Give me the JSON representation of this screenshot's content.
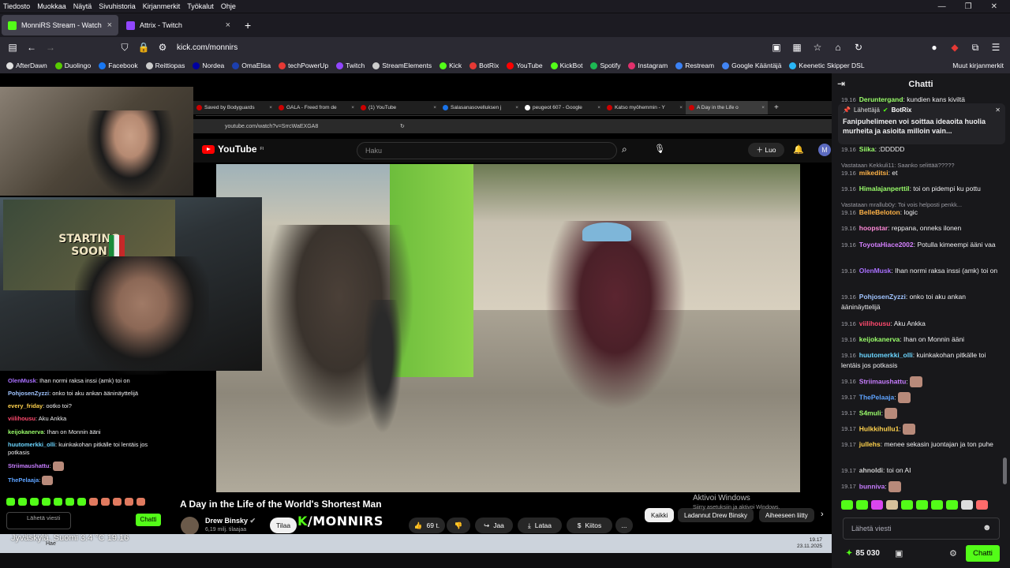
{
  "menubar": [
    "Tiedosto",
    "Muokkaa",
    "Näytä",
    "Sivuhistoria",
    "Kirjanmerkit",
    "Työkalut",
    "Ohje"
  ],
  "tabs": [
    {
      "label": "MonniRS Stream - Watch Li",
      "color": "#53fc18",
      "active": true
    },
    {
      "label": "Attrix - Twitch",
      "color": "#9146ff",
      "active": false
    }
  ],
  "nav": {
    "url": "kick.com/monnirs"
  },
  "bookmarks": [
    {
      "label": "AfterDawn",
      "color": "#e0e0e0"
    },
    {
      "label": "Duolingo",
      "color": "#58cc02"
    },
    {
      "label": "Facebook",
      "color": "#1877f2"
    },
    {
      "label": "Reittiopas",
      "color": "#cccccc"
    },
    {
      "label": "Nordea",
      "color": "#0000a0"
    },
    {
      "label": "OmaElisa",
      "color": "#1c3fae"
    },
    {
      "label": "techPowerUp",
      "color": "#e53935"
    },
    {
      "label": "Twitch",
      "color": "#9146ff"
    },
    {
      "label": "StreamElements",
      "color": "#cccccc"
    },
    {
      "label": "Kick",
      "color": "#53fc18"
    },
    {
      "label": "BotRix",
      "color": "#e53935"
    },
    {
      "label": "YouTube",
      "color": "#ff0000"
    },
    {
      "label": "KickBot",
      "color": "#53fc18"
    },
    {
      "label": "Spotify",
      "color": "#1db954"
    },
    {
      "label": "Instagram",
      "color": "#e1306c"
    },
    {
      "label": "Restream",
      "color": "#3b82f6"
    },
    {
      "label": "Google Kääntäjä",
      "color": "#4285f4"
    },
    {
      "label": "Keenetic Skipper DSL",
      "color": "#29b6f6"
    }
  ],
  "bookmarks_other": "Muut kirjanmerkit",
  "stream": {
    "poster_line1": "STARTING",
    "poster_line2": "SOON",
    "inner_tabs": [
      {
        "label": "Saved by Bodyguards",
        "color": "#cc0000"
      },
      {
        "label": "GALA - Freed from de",
        "color": "#cc0000"
      },
      {
        "label": "(1) YouTube",
        "color": "#cc0000"
      },
      {
        "label": "Salasanasovelluksen j",
        "color": "#1a73e8"
      },
      {
        "label": "peugeot 607 - Google",
        "color": "#ffffff"
      },
      {
        "label": "Katso myöhemmin - Y",
        "color": "#cc0000"
      },
      {
        "label": "A Day in the Life o",
        "color": "#cc0000",
        "active": true
      }
    ],
    "inner_url": "youtube.com/watch?v=SrrcWaEXGA8",
    "yt_logo": "YouTube",
    "yt_logo_sup": "FI",
    "yt_search_placeholder": "Haku",
    "yt_create": "Luo",
    "video_title": "A Day in the Life of the World's Shortest Man",
    "channel": "Drew Binsky",
    "subs": "6,19 milj. tilaajaa",
    "subscribe": "Tilaa",
    "kick_logo_k": "K",
    "kick_logo_rest": "/MONNIRS",
    "likes": "69 t.",
    "share": "Jaa",
    "download": "Lataa",
    "thanks": "Kiitos",
    "more": "...",
    "chips": [
      "Kaikki",
      "Ladannut Drew Binsky",
      "Aiheeseen liitty"
    ],
    "activate": "Aktivoi Windows",
    "activate_sub": "Siirry asetuksiin ja aktivoi Windows.",
    "overlay_chat": [
      {
        "user": "OlenMusk",
        "color": "#a970ff",
        "msg": "Ihan normi raksa inssi (amk) toi on"
      },
      {
        "user": "PohjosenZyzzi",
        "color": "#a0c4ff",
        "msg": "onko toi aku ankan ääninäyttelijä"
      },
      {
        "user": "every_friday",
        "color": "#ffd24d",
        "msg": "ootko toi?"
      },
      {
        "user": "viilihousu",
        "color": "#ff4a6e",
        "msg": "Aku Ankka"
      },
      {
        "user": "keijokanerva",
        "color": "#9bff6b",
        "msg": "Ihan on Monnin ääni"
      },
      {
        "user": "huutomerkki_olli",
        "color": "#6bd5ff",
        "msg": "kuinkakohan pitkälle toi lentäis jos potkasis"
      },
      {
        "user": "Striimaushattu",
        "color": "#c77dff",
        "msg": ""
      },
      {
        "user": "ThePelaaja",
        "color": "#5ea3ff",
        "msg": ""
      }
    ],
    "overlay_input": "Lähetä viesti",
    "overlay_chat_btn": "Chatti",
    "taskbar_text": "Jyväskylä, Suomi  3.4 °C  19.16",
    "search_label": "Hae",
    "clock_time": "19.17",
    "clock_date": "23.11.2025"
  },
  "chat": {
    "title": "Chatti",
    "pinned_by": "Lähettäjä",
    "pinned_user": "BotRix",
    "pinned_msg": "Fanipuhelimeen voi soittaa ideaoita huolia murheita ja asioita milloin vain...",
    "messages": [
      {
        "time": "19.16",
        "user": "Deruntergand",
        "color": "#9bff6b",
        "msg": "kundien kans kiviltä"
      },
      {
        "time": "19.16",
        "user": "Siika",
        "color": "#9bff6b",
        "msg": ":DDDDD"
      },
      {
        "reply": "Vastataan Kekkuli11: Saanko selittää?????"
      },
      {
        "time": "19.16",
        "user": "mikeditsi",
        "color": "#ffb347",
        "msg": "et"
      },
      {
        "time": "19.16",
        "user": "Himalajanperttil",
        "color": "#9bff6b",
        "msg": "toi on pidempi ku pottu"
      },
      {
        "reply": "Vastataan mrallub0y: Toi vois helposti penkk..."
      },
      {
        "time": "19.16",
        "user": "BelleBeloton",
        "color": "#ffb347",
        "msg": "logic"
      },
      {
        "time": "19.16",
        "user": "hoopstar",
        "color": "#ff8ad8",
        "msg": "reppana, onneks ilonen"
      },
      {
        "time": "19.16",
        "user": "ToyotaHiace2002",
        "color": "#d580ff",
        "msg": "Potulla kimeempi ääni vaa"
      },
      {
        "time": "19.16",
        "user": "OlenMusk",
        "color": "#a970ff",
        "msg": "Ihan normi raksa inssi (amk) toi on"
      },
      {
        "time": "19.16",
        "user": "PohjosenZyzzi",
        "color": "#a0c4ff",
        "msg": "onko toi aku ankan ääninäyttelijä"
      },
      {
        "time": "19.16",
        "user": "viilihousu",
        "color": "#ff4a6e",
        "msg": "Aku Ankka"
      },
      {
        "time": "19.16",
        "user": "keijokanerva",
        "color": "#9bff6b",
        "msg": "Ihan on Monnin ääni"
      },
      {
        "time": "19.16",
        "user": "huutomerkki_olli",
        "color": "#6bd5ff",
        "msg": "kuinkakohan pitkälle toi lentäis jos potkasis"
      },
      {
        "time": "19.16",
        "user": "Striimaushattu",
        "color": "#c77dff",
        "msg": ""
      },
      {
        "time": "19.17",
        "user": "ThePelaaja",
        "color": "#5ea3ff",
        "msg": ""
      },
      {
        "time": "19.17",
        "user": "S4muli",
        "color": "#9bff6b",
        "msg": ""
      },
      {
        "time": "19.17",
        "user": "Hulkkihullu1",
        "color": "#ffd24d",
        "msg": ""
      },
      {
        "time": "19.17",
        "user": "jullehs",
        "color": "#ffd24d",
        "msg": "menee sekasin juontajan ja ton puhe"
      },
      {
        "time": "19.17",
        "user": "ahnoldi",
        "color": "#cfcfcf",
        "msg": "toi on AI"
      },
      {
        "time": "19.17",
        "user": "bunniva",
        "color": "#c77dff",
        "msg": ""
      }
    ],
    "input_placeholder": "Lähetä viesti",
    "points": "85 030",
    "send": "Chatti"
  }
}
